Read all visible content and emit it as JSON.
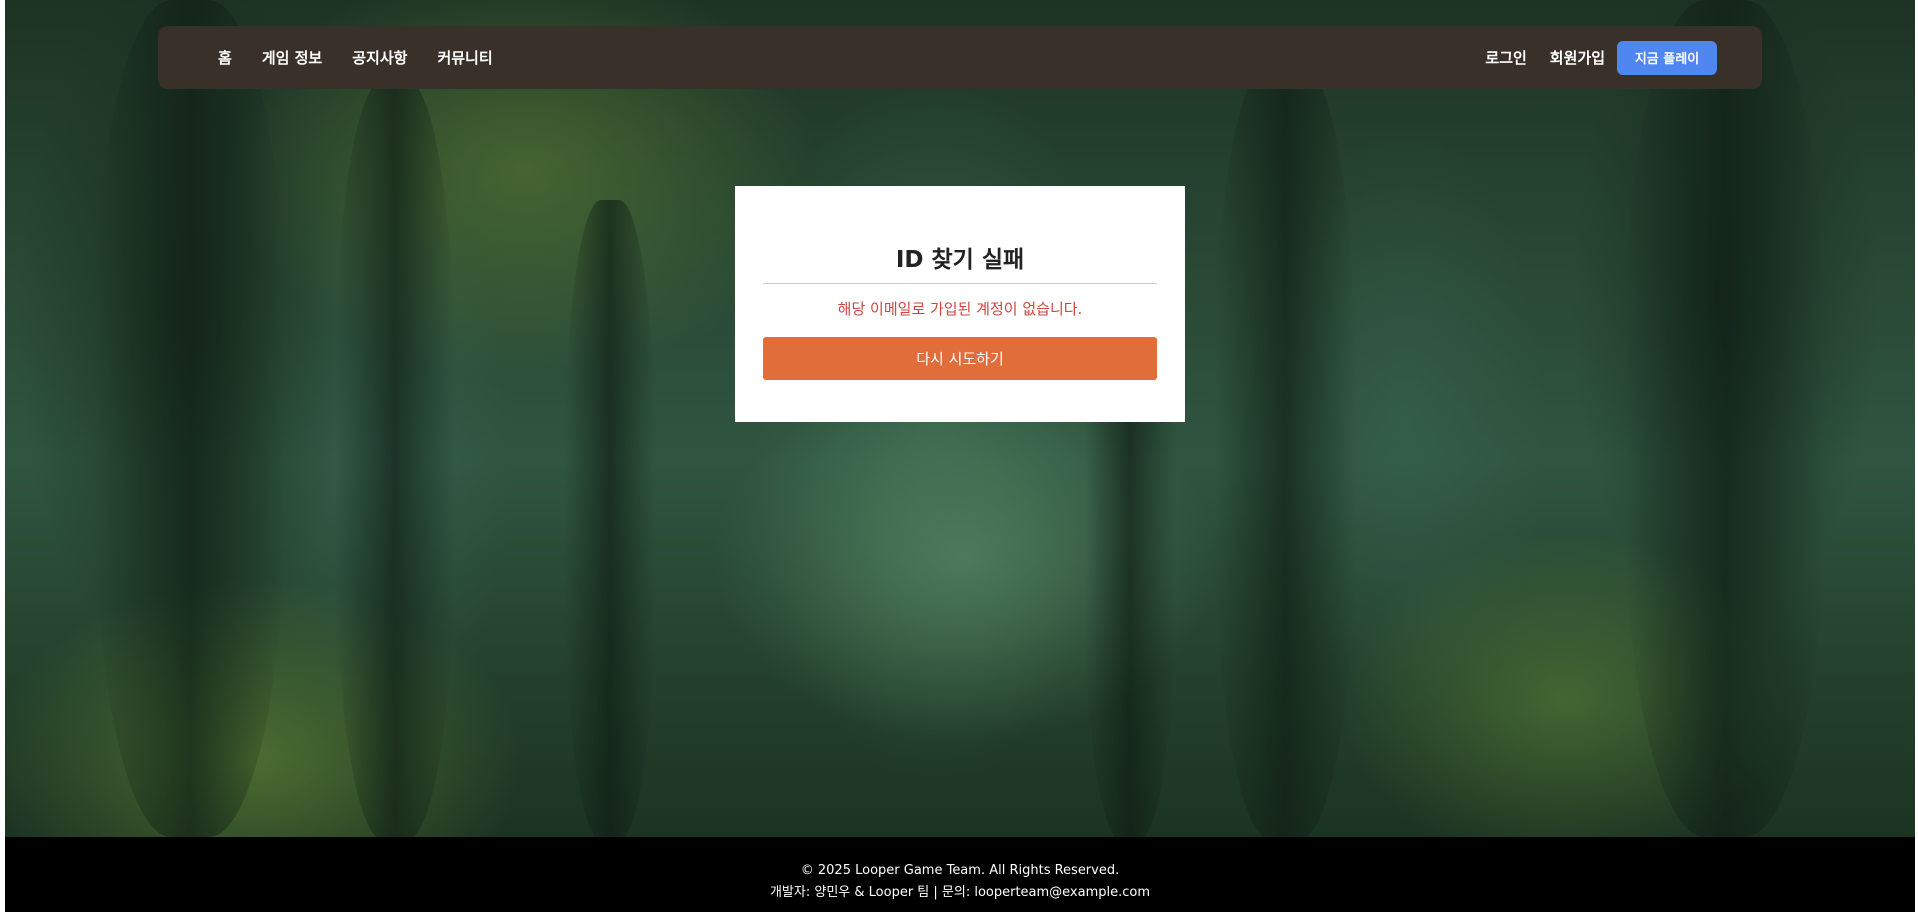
{
  "nav": {
    "links": [
      "홈",
      "게임 정보",
      "공지사항",
      "커뮤니티"
    ],
    "login": "로그인",
    "signup": "회원가입",
    "play_now": "지금 플레이"
  },
  "card": {
    "title": "ID 찾기 실패",
    "message": "해당 이메일로 가입된 계정이 없습니다.",
    "retry": "다시 시도하기"
  },
  "footer": {
    "copyright": "© 2025 Looper Game Team. All Rights Reserved.",
    "contact": "개발자: 양민우 & Looper 팀 | 문의: looperteam@example.com"
  },
  "colors": {
    "nav_bg": "#3a302a",
    "play_button": "#4f86f0",
    "retry_button": "#e06d3a",
    "error_text": "#d0453e"
  }
}
